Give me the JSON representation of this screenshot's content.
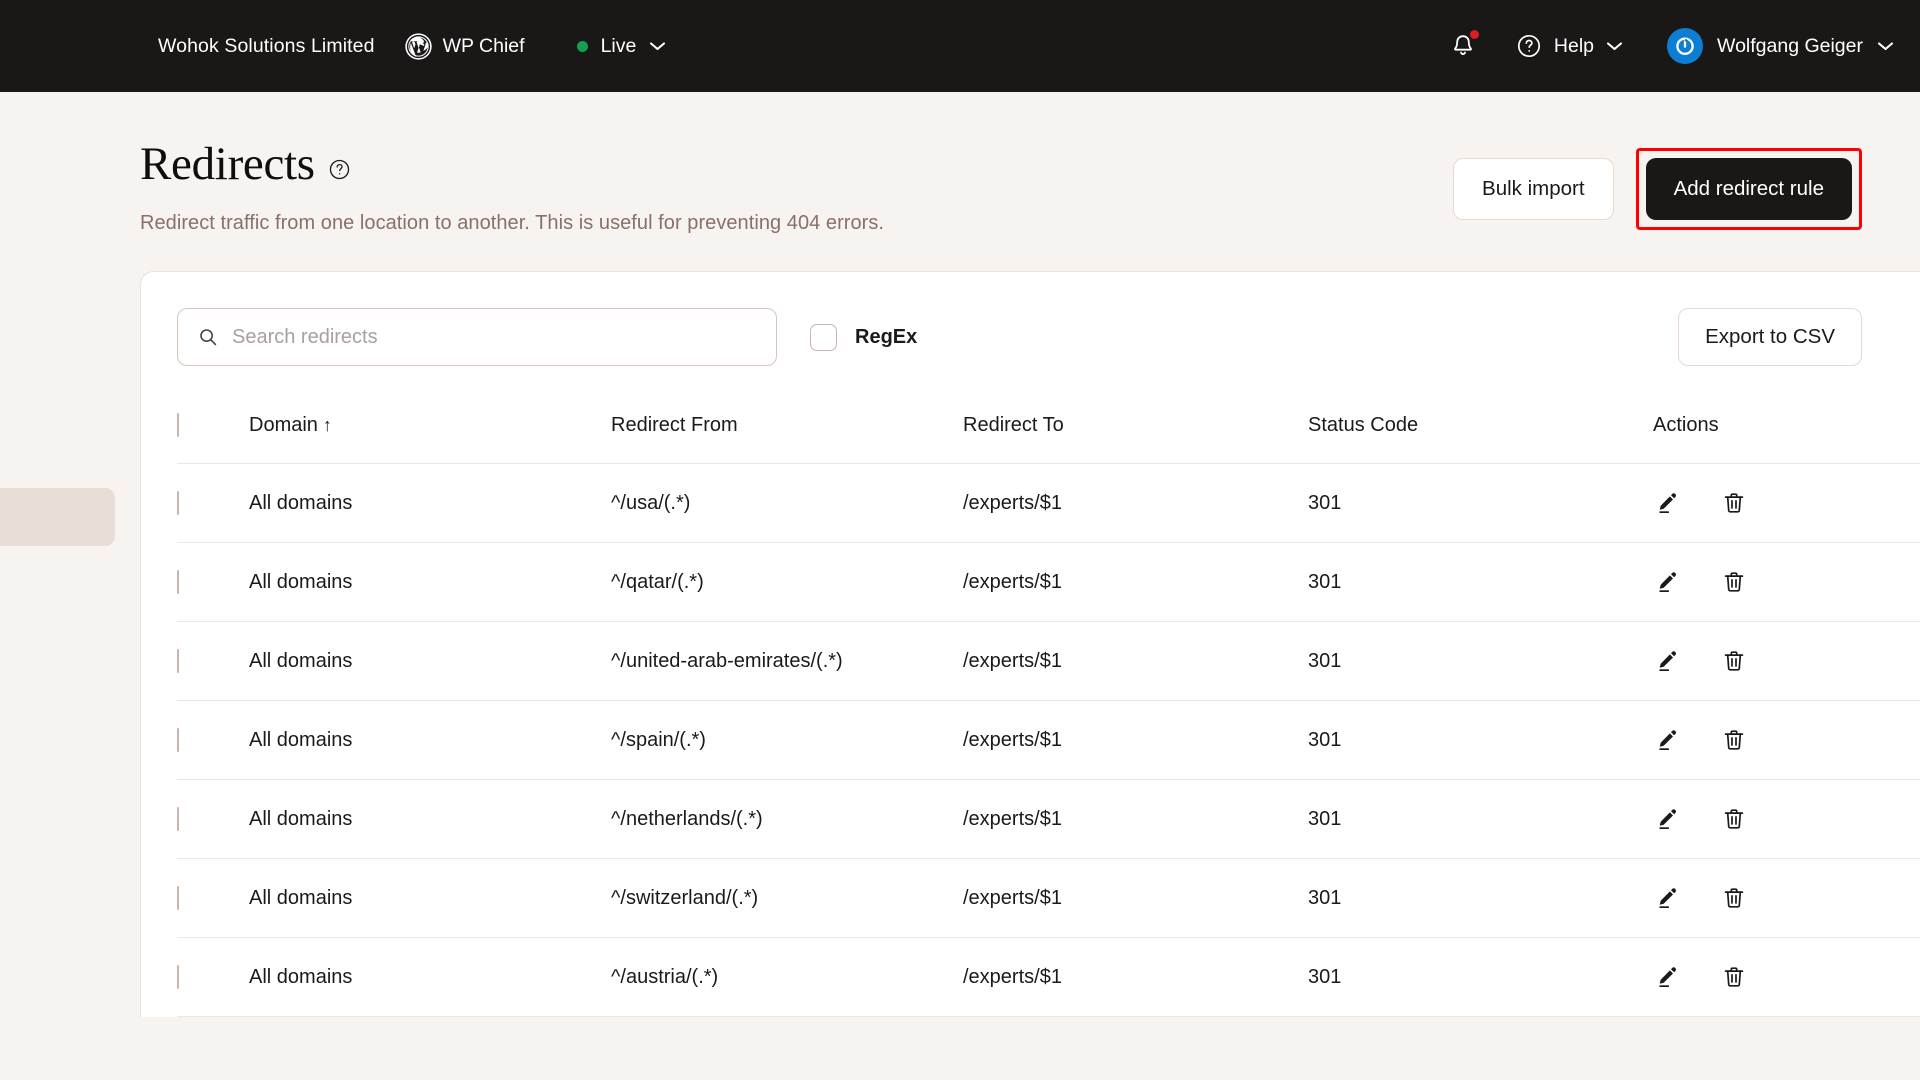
{
  "topbar": {
    "org_name": "Wohok Solutions Limited",
    "site_name": "WP Chief",
    "site_icon": "wordpress-icon",
    "env_label": "Live",
    "env_status_color": "#12A150",
    "env_chevron_icon": "chevron-down-icon",
    "notifications_icon": "bell-icon",
    "notifications_badge_color": "#E01B24",
    "help_icon": "question-circle-icon",
    "help_label": "Help",
    "help_chevron_icon": "chevron-down-icon",
    "avatar_icon": "power-avatar-icon",
    "avatar_color": "#0C7FD4",
    "user_name": "Wolfgang Geiger",
    "user_chevron_icon": "chevron-down-icon",
    "background_color": "#1A1717"
  },
  "page": {
    "title": "Redirects",
    "title_help_icon": "question-circle-icon",
    "subtitle": "Redirect traffic from one location to another. This is useful for preventing 404 errors.",
    "background_color": "#F7F3F0"
  },
  "header_actions": {
    "bulk_import_label": "Bulk import",
    "add_rule_label": "Add redirect rule",
    "highlight_color": "#FF0000"
  },
  "toolbar": {
    "search_placeholder": "Search redirects",
    "search_value": "",
    "search_icon": "search-icon",
    "regex_label": "RegEx",
    "regex_checked": false,
    "export_label": "Export to CSV"
  },
  "table": {
    "select_all_checked": false,
    "sort_column": "Domain",
    "sort_direction_glyph": "↑",
    "columns": [
      "Domain",
      "Redirect From",
      "Redirect To",
      "Status Code",
      "Actions"
    ],
    "row_action_icons": [
      "pencil-icon",
      "trash-icon"
    ],
    "rows": [
      {
        "checked": false,
        "domain": "All domains",
        "redirect_from": "^/usa/(.*)",
        "redirect_to": "/experts/$1",
        "status_code": "301"
      },
      {
        "checked": false,
        "domain": "All domains",
        "redirect_from": "^/qatar/(.*)",
        "redirect_to": "/experts/$1",
        "status_code": "301"
      },
      {
        "checked": false,
        "domain": "All domains",
        "redirect_from": "^/united-arab-emirates/(.*)",
        "redirect_to": "/experts/$1",
        "status_code": "301"
      },
      {
        "checked": false,
        "domain": "All domains",
        "redirect_from": "^/spain/(.*)",
        "redirect_to": "/experts/$1",
        "status_code": "301"
      },
      {
        "checked": false,
        "domain": "All domains",
        "redirect_from": "^/netherlands/(.*)",
        "redirect_to": "/experts/$1",
        "status_code": "301"
      },
      {
        "checked": false,
        "domain": "All domains",
        "redirect_from": "^/switzerland/(.*)",
        "redirect_to": "/experts/$1",
        "status_code": "301"
      },
      {
        "checked": false,
        "domain": "All domains",
        "redirect_from": "^/austria/(.*)",
        "redirect_to": "/experts/$1",
        "status_code": "301"
      }
    ]
  }
}
